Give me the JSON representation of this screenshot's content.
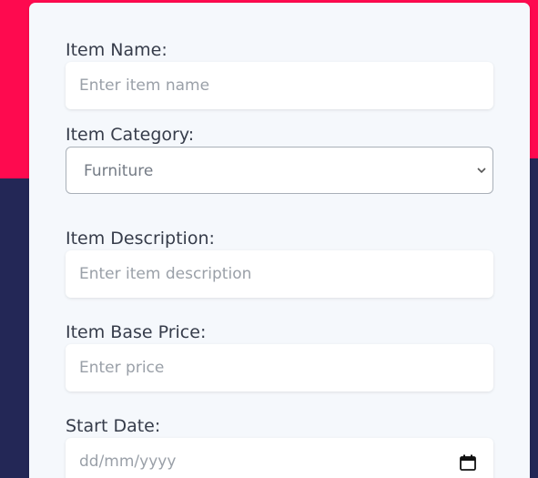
{
  "colors": {
    "accent_red": "#fe0a4f",
    "navy": "#232756",
    "card": "#f5f8fc"
  },
  "form": {
    "item_name": {
      "label": "Item Name:",
      "placeholder": "Enter item name",
      "value": ""
    },
    "item_category": {
      "label": "Item Category:",
      "selected": "Furniture"
    },
    "item_description": {
      "label": "Item Description:",
      "placeholder": "Enter item description",
      "value": ""
    },
    "item_base_price": {
      "label": "Item Base Price:",
      "placeholder": "Enter price",
      "value": ""
    },
    "start_date": {
      "label": "Start Date:",
      "placeholder": "dd/mm/yyyy",
      "icon": "calendar-icon"
    }
  }
}
